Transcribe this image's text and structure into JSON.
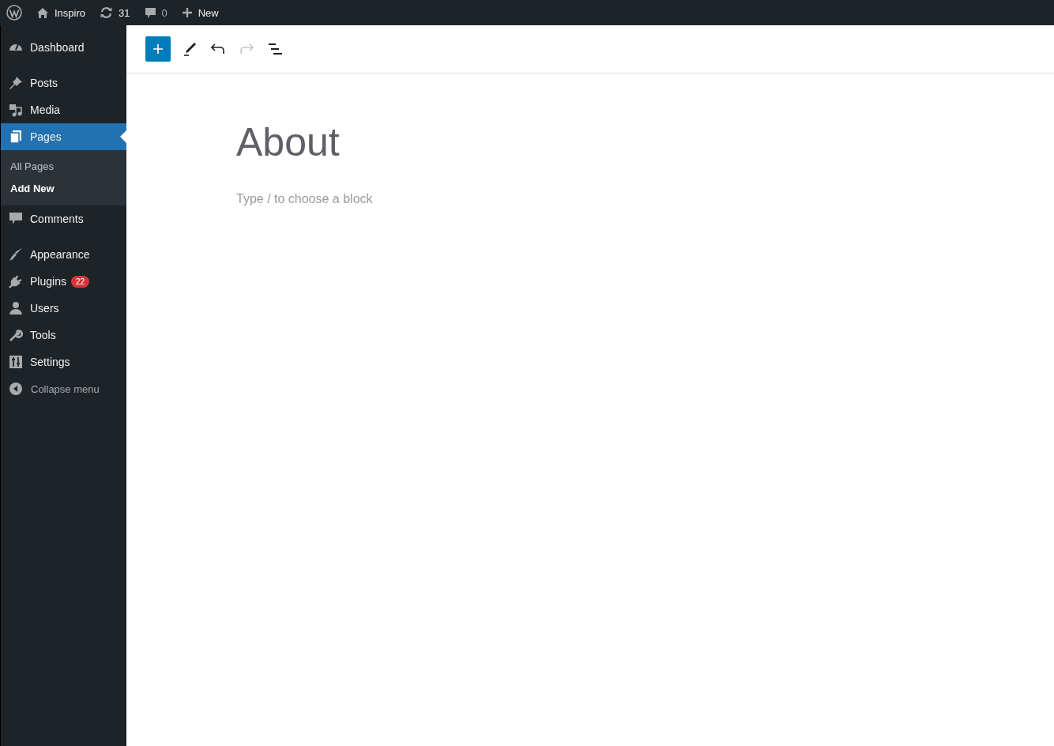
{
  "admin_bar": {
    "site": "Inspiro",
    "updates": "31",
    "comments": "0",
    "new": "New"
  },
  "menu_groups": [
    [
      {
        "label": "Dashboard",
        "selected": false
      }
    ],
    [
      {
        "label": "Posts",
        "selected": false
      },
      {
        "label": "Media",
        "selected": false
      },
      {
        "label": "Pages",
        "selected": true,
        "submenu": [
          {
            "label": "All Pages",
            "selected": false
          },
          {
            "label": "Add New",
            "selected": true
          }
        ]
      },
      {
        "label": "Comments",
        "selected": false
      }
    ],
    [
      {
        "label": "Appearance",
        "selected": false
      },
      {
        "label": "Plugins",
        "selected": false,
        "badge": "22"
      },
      {
        "label": "Users",
        "selected": false
      },
      {
        "label": "Tools",
        "selected": false
      },
      {
        "label": "Settings",
        "selected": false
      }
    ]
  ],
  "collapse": "Collapse menu",
  "toolbar": [
    {
      "kind": "add",
      "disabled": false
    },
    {
      "kind": "edit",
      "disabled": false
    },
    {
      "kind": "undo",
      "disabled": false
    },
    {
      "kind": "redo",
      "disabled": true
    },
    {
      "kind": "outline",
      "disabled": false
    }
  ],
  "editor": {
    "title": "About",
    "placeholder": "Type / to choose a block"
  }
}
